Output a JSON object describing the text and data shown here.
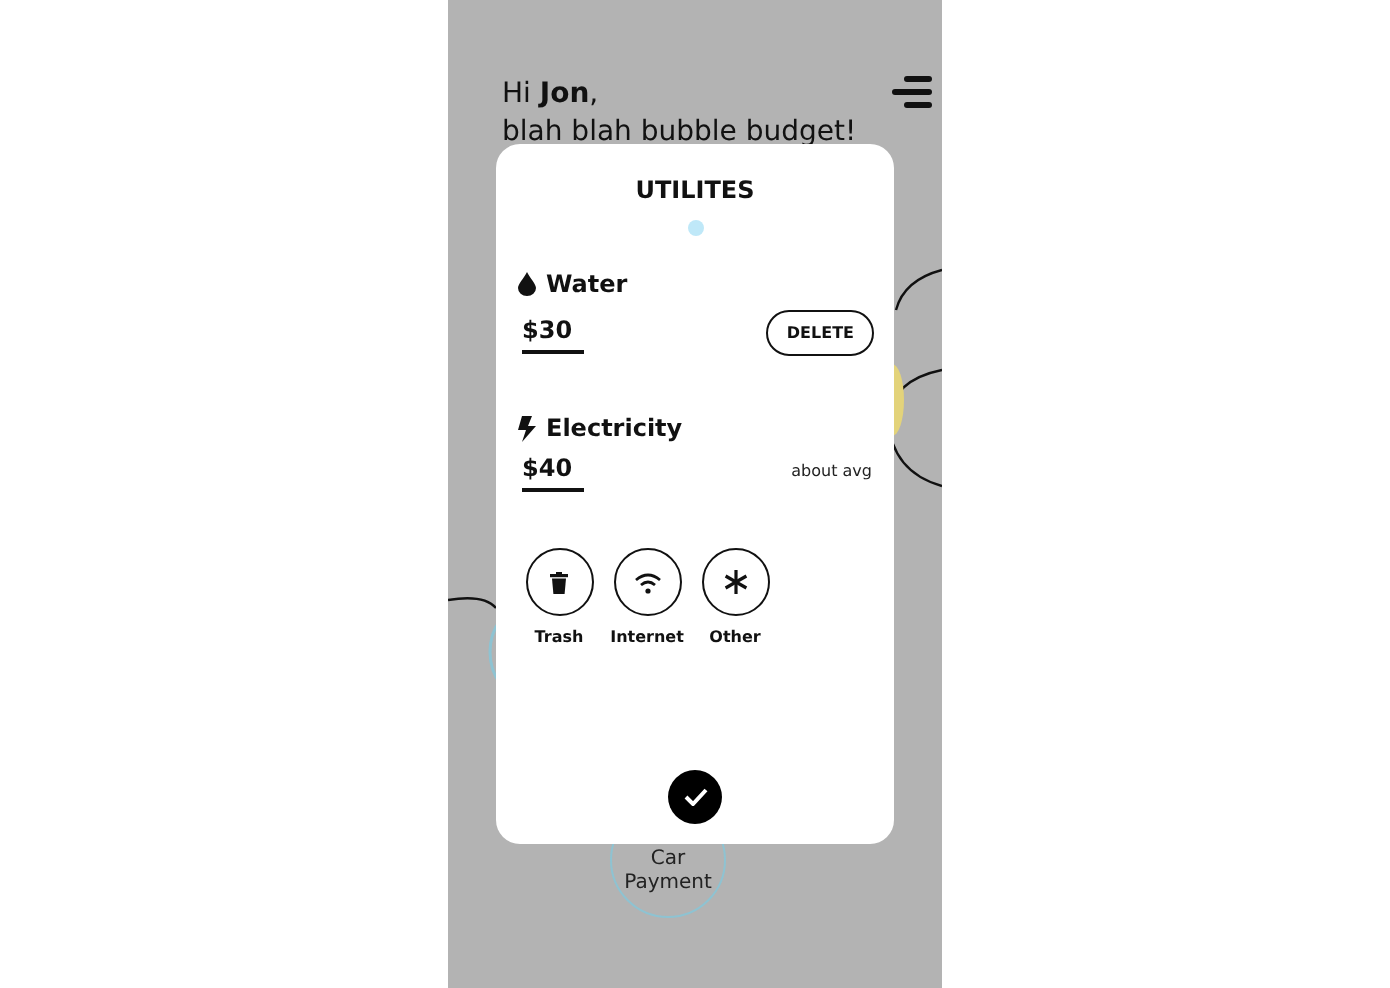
{
  "greeting": {
    "line_1": "Hi **Jon**,",
    "line_2": "blah blah bubble budget!"
  },
  "background_bubbles": [
    {
      "label": "Car Payment"
    }
  ],
  "modal": {
    "title": "UTILITES",
    "utilities": [
      {
        "name": "Water",
        "amount": "$30",
        "action": {
          "kind": "button",
          "text": "DELETE"
        }
      },
      {
        "name": "Electricity",
        "amount": "$40",
        "action": {
          "kind": "note",
          "text": "about avg"
        }
      }
    ],
    "categories": [
      {
        "label": "Trash"
      },
      {
        "label": "Internet"
      },
      {
        "label": "Other"
      }
    ]
  }
}
